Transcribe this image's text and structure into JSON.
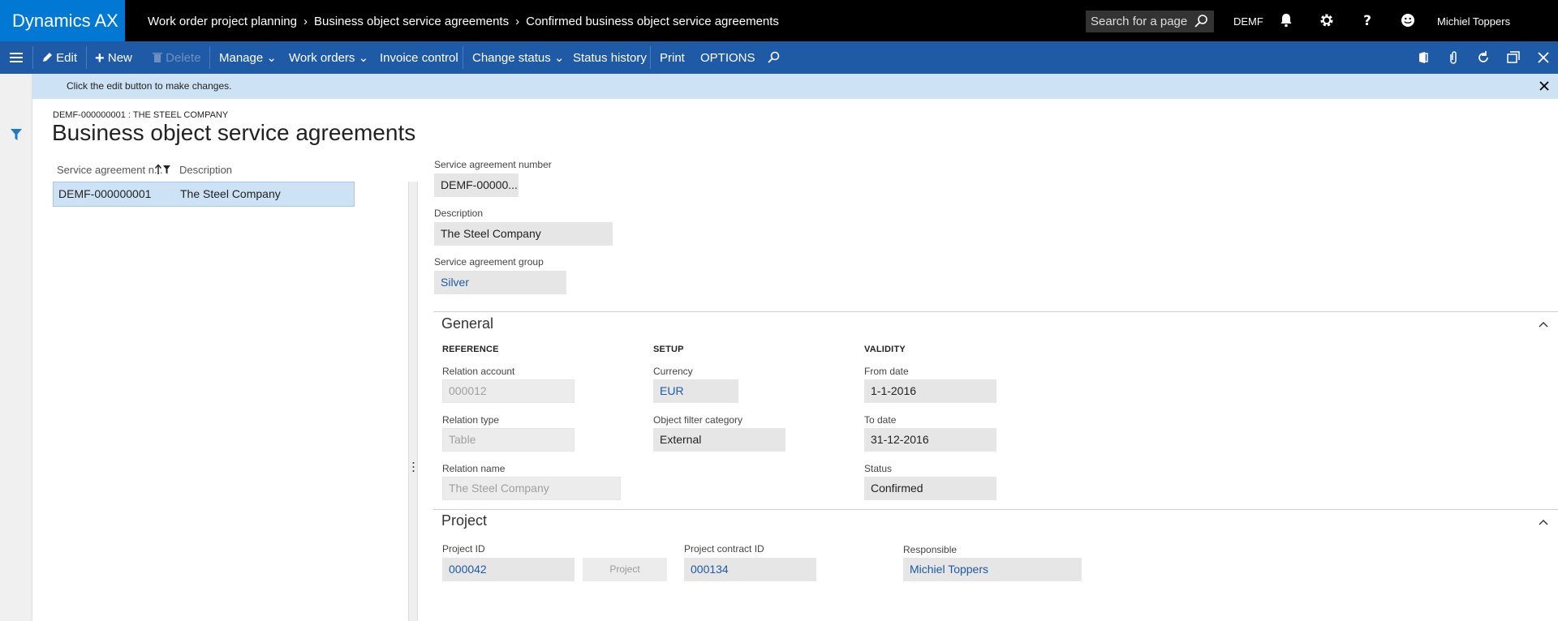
{
  "app": {
    "brand": "Dynamics AX"
  },
  "breadcrumb": [
    "Work order project planning",
    "Business object service agreements",
    "Confirmed business object service agreements"
  ],
  "topbar": {
    "search_placeholder": "Search for a page",
    "company": "DEMF",
    "user": "Michiel Toppers"
  },
  "actions": {
    "edit": "Edit",
    "new": "New",
    "delete": "Delete",
    "manage": "Manage",
    "work_orders": "Work orders",
    "invoice_control": "Invoice control",
    "change_status": "Change status",
    "status_history": "Status history",
    "print": "Print",
    "options": "OPTIONS"
  },
  "info": {
    "message": "Click the edit button to make changes."
  },
  "header": {
    "record_id": "DEMF-000000001 : THE STEEL COMPANY",
    "title": "Business object service agreements"
  },
  "grid": {
    "columns": [
      "Service agreement n...",
      "Description"
    ],
    "rows": [
      {
        "number": "DEMF-000000001",
        "description": "The Steel Company"
      }
    ]
  },
  "details": {
    "number_label": "Service agreement number",
    "number_value": "DEMF-00000...",
    "description_label": "Description",
    "description_value": "The Steel Company",
    "group_label": "Service agreement group",
    "group_value": "Silver"
  },
  "general": {
    "title": "General",
    "reference": {
      "heading": "REFERENCE",
      "relation_account_label": "Relation account",
      "relation_account_value": "000012",
      "relation_type_label": "Relation type",
      "relation_type_value": "Table",
      "relation_name_label": "Relation name",
      "relation_name_value": "The Steel Company"
    },
    "setup": {
      "heading": "SETUP",
      "currency_label": "Currency",
      "currency_value": "EUR",
      "filter_label": "Object filter category",
      "filter_value": "External"
    },
    "validity": {
      "heading": "VALIDITY",
      "from_label": "From date",
      "from_value": "1-1-2016",
      "to_label": "To date",
      "to_value": "31-12-2016",
      "status_label": "Status",
      "status_value": "Confirmed"
    }
  },
  "project": {
    "title": "Project",
    "project_id_label": "Project ID",
    "project_id_value": "000042",
    "project_button": "Project",
    "contract_label": "Project contract ID",
    "contract_value": "000134",
    "responsible_label": "Responsible",
    "responsible_value": "Michiel Toppers"
  },
  "colors": {
    "brand": "#0078d4",
    "actionbar": "#1f5aa6",
    "info": "#cde2f5",
    "link": "#1f5aa6"
  }
}
